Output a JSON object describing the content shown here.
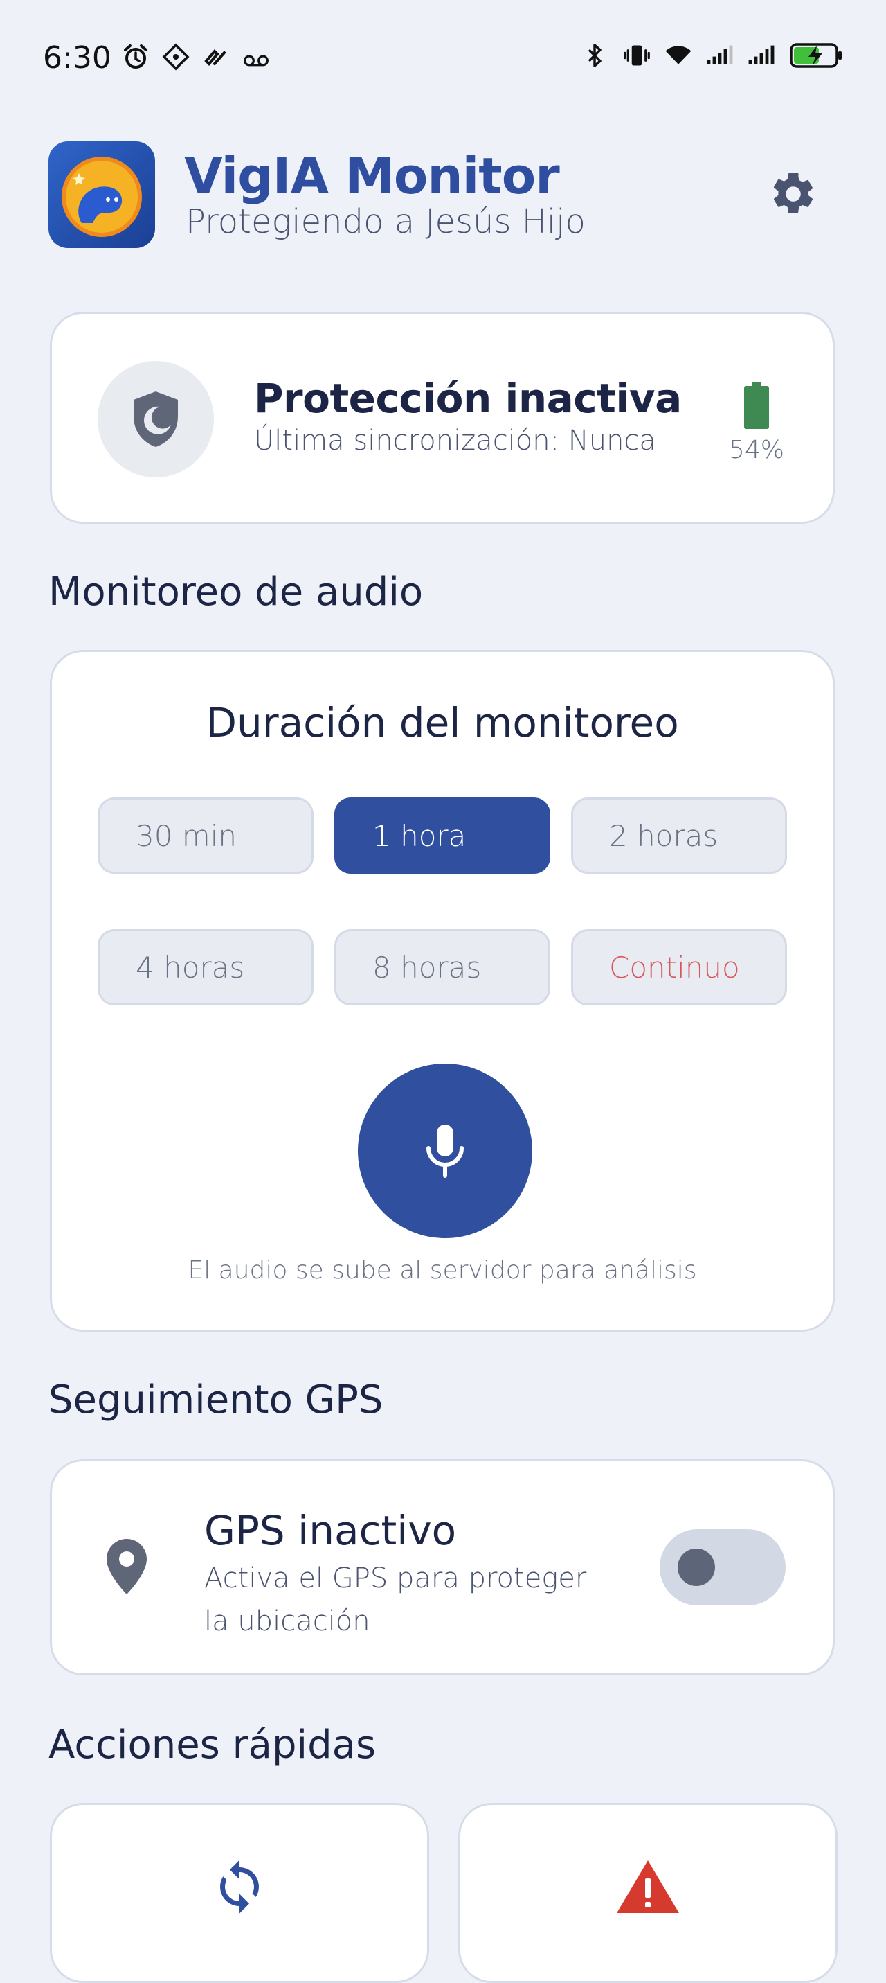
{
  "status_bar": {
    "time": "6:30",
    "icons_left": [
      "alarm-icon",
      "app-notification-icon",
      "gesture-icon",
      "voicemail-icon"
    ],
    "icons_right": [
      "bluetooth-icon",
      "vibrate-icon",
      "wifi-icon",
      "signal-icon",
      "signal-icon",
      "battery-charging-icon"
    ]
  },
  "header": {
    "title": "VigIA Monitor",
    "subtitle": "Protegiendo a Jesús Hijo"
  },
  "protection": {
    "status": "Protección inactiva",
    "last_sync": "Última sincronización: Nunca",
    "battery": "54%",
    "battery_level_percent": 54
  },
  "audio": {
    "section_title": "Monitoreo de audio",
    "card_title": "Duración del monitoreo",
    "durations": [
      {
        "label": "30 min",
        "selected": false
      },
      {
        "label": "1 hora",
        "selected": true
      },
      {
        "label": "2 horas",
        "selected": false
      },
      {
        "label": "4 horas",
        "selected": false
      },
      {
        "label": "8 horas",
        "selected": false
      },
      {
        "label": "Continuo",
        "selected": false
      }
    ],
    "note": "El audio se sube al servidor para análisis"
  },
  "gps": {
    "section_title": "Seguimiento GPS",
    "status": "GPS inactivo",
    "description": "Activa el GPS para proteger la ubicación",
    "enabled": false
  },
  "quick_actions": {
    "section_title": "Acciones rápidas",
    "items": [
      "refresh-icon",
      "alert-icon"
    ]
  },
  "colors": {
    "primary": "#30509f",
    "title": "#2f4ea0",
    "danger": "#d9575a",
    "battery": "#3f8a52",
    "alert": "#d63a2f"
  }
}
